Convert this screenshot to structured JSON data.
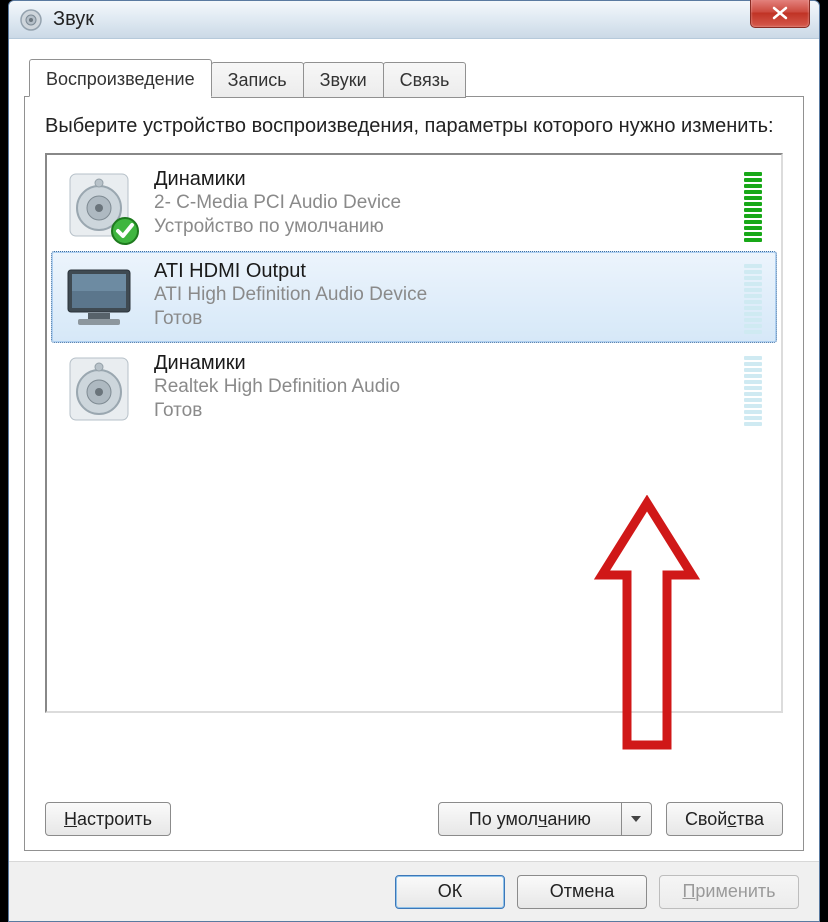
{
  "window": {
    "title": "Звук"
  },
  "tabs": [
    {
      "label": "Воспроизведение",
      "active": true
    },
    {
      "label": "Запись",
      "active": false
    },
    {
      "label": "Звуки",
      "active": false
    },
    {
      "label": "Связь",
      "active": false
    }
  ],
  "prompt": "Выберите устройство воспроизведения, параметры которого нужно изменить:",
  "devices": [
    {
      "name": "Динамики",
      "driver": "2- C-Media PCI Audio Device",
      "status": "Устройство по умолчанию",
      "icon": "speaker",
      "default": true,
      "selected": false,
      "level": {
        "filled": 12,
        "total": 12,
        "style": "green"
      }
    },
    {
      "name": "ATI HDMI Output",
      "driver": "ATI High Definition Audio Device",
      "status": "Готов",
      "icon": "monitor",
      "default": false,
      "selected": true,
      "level": {
        "filled": 0,
        "total": 12,
        "style": "teal"
      }
    },
    {
      "name": "Динамики",
      "driver": "Realtek High Definition Audio",
      "status": "Готов",
      "icon": "speaker",
      "default": false,
      "selected": false,
      "level": {
        "filled": 0,
        "total": 12,
        "style": "teal"
      }
    }
  ],
  "panel_buttons": {
    "configure": "Настроить",
    "set_default": "По умолчанию",
    "properties": "Свойства"
  },
  "bottom_buttons": {
    "ok": "ОК",
    "cancel": "Отмена",
    "apply": "Применить"
  },
  "underline": {
    "configure_idx": 0,
    "set_default_idx": 7,
    "properties_idx": 4,
    "apply_idx": 0
  }
}
